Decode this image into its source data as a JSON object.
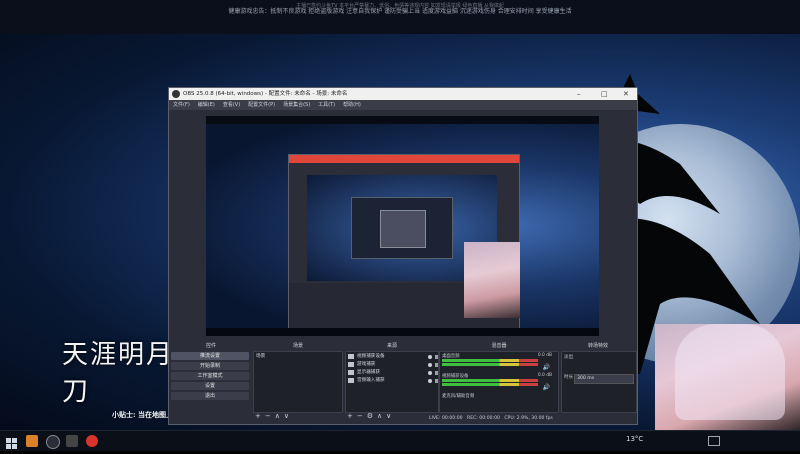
{
  "topbar": {
    "line1": "主播已签约斗鱼TV 本平台严禁暴力、低俗、色情等违规内容 如发现请举报 绿色直播 从我做起",
    "notice": "健康游戏忠告：抵制不良游戏 拒绝盗版游戏 注意自我保护 谨防受骗上当 适度游戏益脑 沉迷游戏伤身 合理安排时间 享受健康生活"
  },
  "stream": {
    "logo_text": "天涯明月刀",
    "tip": "小贴士: 当在地图上"
  },
  "obs": {
    "title": "OBS 25.0.8 (64-bit, windows) - 配置文件: 未命名 - 场景: 未命名",
    "menu": [
      "文件(F)",
      "编辑(E)",
      "查看(V)",
      "配置文件(P)",
      "场景集合(S)",
      "工具(T)",
      "帮助(H)"
    ],
    "docks": {
      "controls": "控件",
      "scenes": "场景",
      "sources": "来源",
      "mixer": "混音器",
      "transitions": "转场特效"
    },
    "controls": [
      "推流设置",
      "开始录制",
      "工作室模式",
      "设置",
      "退出"
    ],
    "scenes": [
      "场景"
    ],
    "sources": [
      {
        "label": "视频捕获设备",
        "icon": "camera-icon"
      },
      {
        "label": "游戏捕获",
        "icon": "gamepad-icon"
      },
      {
        "label": "显示器捕获",
        "icon": "monitor-icon"
      },
      {
        "label": "音频输入捕获",
        "icon": "mic-icon"
      }
    ],
    "mixer": [
      {
        "name": "桌面音频",
        "db": "0.0 dB"
      },
      {
        "name": "视频捕获设备",
        "db": "0.0 dB"
      },
      {
        "name": "麦克风/辅助音频",
        "db": ""
      }
    ],
    "transitions": {
      "fade": "淡出",
      "duration_label": "时长",
      "duration_value": "300 ms"
    },
    "status": {
      "live": "LIVE: 00:00:00",
      "rec": "REC: 00:00:00",
      "cpu": "CPU: 2.9%, 30.00 fps"
    }
  },
  "taskbar": {
    "weather": "13°C"
  },
  "colors": {
    "obs_bg": "#2b2e38",
    "accent_red": "#e0463a",
    "meter_green": "#3fbf3f"
  }
}
